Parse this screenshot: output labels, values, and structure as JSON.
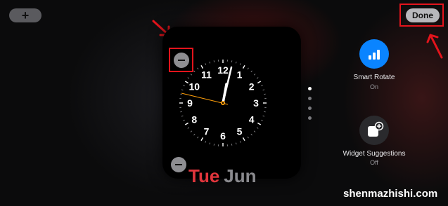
{
  "toolbar": {
    "add_label": "+",
    "done_label": "Done"
  },
  "widget": {
    "clock_numerals": [
      "12",
      "1",
      "2",
      "3",
      "4",
      "5",
      "6",
      "7",
      "8",
      "9",
      "10",
      "11"
    ],
    "date_day": "Tue",
    "date_month": "Jun"
  },
  "page_dots": {
    "count": 4,
    "active_index": 0
  },
  "options": {
    "smart_rotate": {
      "label": "Smart Rotate",
      "status": "On",
      "icon": "signal-bars-icon"
    },
    "widget_suggestions": {
      "label": "Widget Suggestions",
      "status": "Off",
      "icon": "add-widget-icon"
    }
  },
  "watermark": "shenmazhishi.com",
  "colors": {
    "accent_blue": "#0a84ff",
    "date_red": "#e0353c",
    "annotation_red": "#e3141c",
    "second_hand": "#ff9f0a"
  }
}
